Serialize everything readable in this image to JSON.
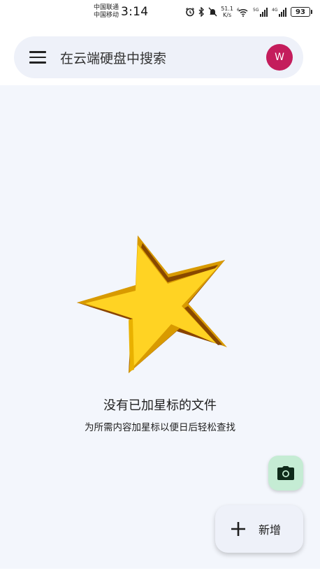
{
  "status_bar": {
    "carrier_1": "中国联通",
    "carrier_2": "中国移动",
    "time": "3:14",
    "net_speed_value": "51.1",
    "net_speed_unit": "K/s",
    "wifi_badge": "6",
    "signal_1_label": "5G",
    "signal_2_label": "4G",
    "battery": "93"
  },
  "search": {
    "placeholder": "在云端硬盘中搜索",
    "avatar_initial": "W",
    "avatar_color": "#c41d5c"
  },
  "empty_state": {
    "title": "没有已加星标的文件",
    "subtitle": "为所需内容加星标以便日后轻松查找",
    "illustration": "star-icon"
  },
  "fab": {
    "camera_icon": "camera-icon",
    "new_label": "新增",
    "camera_color": "#c5ecd4"
  },
  "colors": {
    "background": "#f3f6fc",
    "search_bg": "#eef1f9",
    "star_fill": "#ffd323",
    "star_edge": "#d89a00"
  }
}
